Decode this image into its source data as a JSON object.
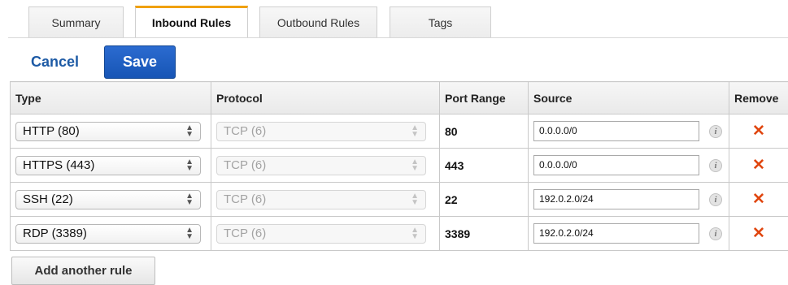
{
  "tabs": [
    {
      "label": "Summary",
      "active": false
    },
    {
      "label": "Inbound Rules",
      "active": true
    },
    {
      "label": "Outbound Rules",
      "active": false
    },
    {
      "label": "Tags",
      "active": false
    }
  ],
  "actions": {
    "cancel_label": "Cancel",
    "save_label": "Save"
  },
  "table": {
    "headers": {
      "type": "Type",
      "protocol": "Protocol",
      "port_range": "Port Range",
      "source": "Source",
      "remove": "Remove"
    },
    "rows": [
      {
        "type": "HTTP (80)",
        "protocol": "TCP (6)",
        "port_range": "80",
        "source": "0.0.0.0/0"
      },
      {
        "type": "HTTPS (443)",
        "protocol": "TCP (6)",
        "port_range": "443",
        "source": "0.0.0.0/0"
      },
      {
        "type": "SSH (22)",
        "protocol": "TCP (6)",
        "port_range": "22",
        "source": "192.0.2.0/24"
      },
      {
        "type": "RDP (3389)",
        "protocol": "TCP (6)",
        "port_range": "3389",
        "source": "192.0.2.0/24"
      }
    ]
  },
  "add_rule_label": "Add another rule",
  "icons": {
    "info": "info-icon",
    "remove": "remove-x-icon",
    "select_arrows": "select-arrows-icon"
  },
  "colors": {
    "active_tab_accent": "#f0a10f",
    "save_button": "#1d5fc2",
    "link": "#1d5aa5",
    "remove": "#e0460f"
  }
}
